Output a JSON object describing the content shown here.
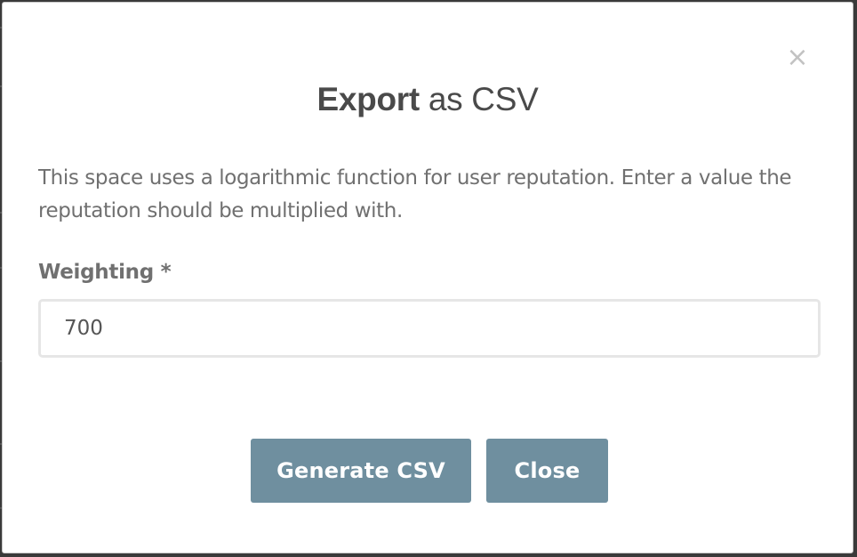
{
  "dialog": {
    "title_bold": "Export",
    "title_rest": " as CSV",
    "close_symbol": "×",
    "description": "This space uses a logarithmic function for user reputation. Enter a value the reputation should be multiplied with.",
    "field": {
      "label": "Weighting *",
      "value": "700"
    },
    "buttons": {
      "generate_label": "Generate CSV",
      "close_label": "Close"
    }
  },
  "colors": {
    "button_background": "#6f8f9f",
    "title_text": "#4a4a4a",
    "body_text": "#707070",
    "close_icon": "#c2c2c2"
  },
  "icons": {
    "close": "close-icon"
  }
}
